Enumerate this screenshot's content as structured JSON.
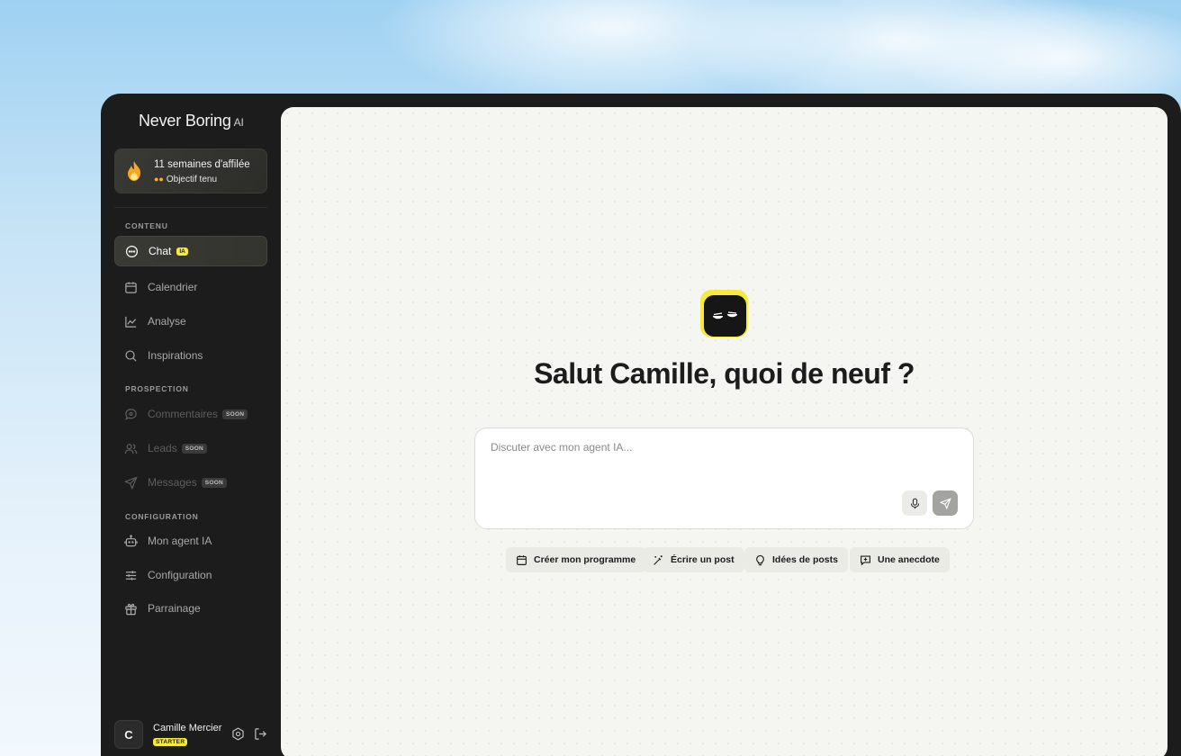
{
  "brand": {
    "name": "Never Boring",
    "suffix": "AI"
  },
  "streak": {
    "title": "11 semaines d'affilée",
    "subtitle": "Objectif tenu",
    "icon": "flame-icon"
  },
  "sidebar": {
    "sections": {
      "content": "CONTENU",
      "prospection": "PROSPECTION",
      "configuration": "CONFIGURATION"
    },
    "items": [
      {
        "label": "Chat",
        "badge": "IA",
        "icon": "chat-bubble-icon",
        "active": true
      },
      {
        "label": "Calendrier",
        "icon": "calendar-icon"
      },
      {
        "label": "Analyse",
        "icon": "chart-line-icon"
      },
      {
        "label": "Inspirations",
        "icon": "search-icon"
      },
      {
        "label": "Commentaires",
        "badge": "SOON",
        "icon": "comment-icon",
        "disabled": true
      },
      {
        "label": "Leads",
        "badge": "SOON",
        "icon": "users-icon",
        "disabled": true
      },
      {
        "label": "Messages",
        "badge": "SOON",
        "icon": "send-icon",
        "disabled": true
      },
      {
        "label": "Mon agent IA",
        "icon": "robot-icon"
      },
      {
        "label": "Configuration",
        "icon": "sliders-icon"
      },
      {
        "label": "Parrainage",
        "icon": "gift-icon"
      }
    ]
  },
  "user": {
    "initial": "C",
    "name": "Camille Mercier",
    "plan": "STARTER"
  },
  "main": {
    "greeting": "Salut Camille, quoi de neuf ?",
    "input_placeholder": "Discuter avec mon agent IA...",
    "chips": [
      {
        "label": "Créer mon programme",
        "icon": "calendar-icon"
      },
      {
        "label": "Écrire un post",
        "icon": "magic-wand-icon"
      },
      {
        "label": "Idées de posts",
        "icon": "lightbulb-icon"
      },
      {
        "label": "Une anecdote",
        "icon": "message-plus-icon"
      }
    ]
  },
  "colors": {
    "accent": "#f7ea3a",
    "sidebar_bg": "#1c1c1c",
    "main_bg": "#f5f5f1"
  }
}
